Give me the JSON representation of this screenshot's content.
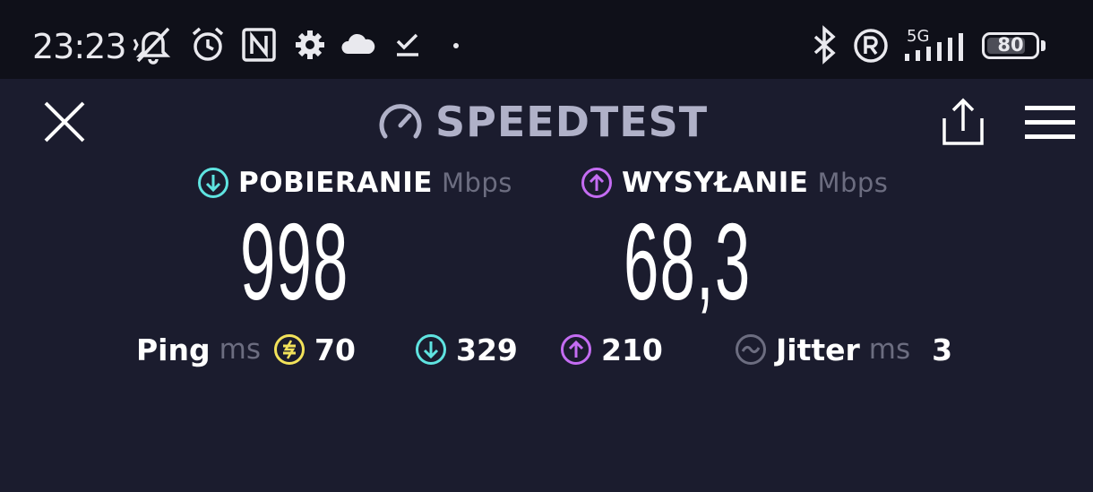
{
  "status_bar": {
    "time": "23:23",
    "network": "5G",
    "battery_level": "80",
    "battery_fraction": 0.8,
    "icons": [
      "muted-bell-icon",
      "alarm-icon",
      "nfc-icon",
      "settings-icon",
      "cloud-icon",
      "download-done-icon",
      "dot-icon",
      "bluetooth-icon",
      "registered-icon",
      "signal-icon",
      "battery-icon"
    ]
  },
  "header": {
    "title": "SPEEDTEST",
    "close_icon": "close-icon",
    "share_icon": "share-icon",
    "menu_icon": "menu-icon"
  },
  "download": {
    "label": "POBIERANIE",
    "unit": "Mbps",
    "value": "998",
    "color": "#5fe3e0"
  },
  "upload": {
    "label": "WYSYŁANIE",
    "unit": "Mbps",
    "value": "68,3",
    "color": "#c46cf2"
  },
  "ping": {
    "label": "Ping",
    "unit": "ms",
    "idle_value": "70",
    "download_value": "329",
    "upload_value": "210",
    "idle_color": "#f2e25a"
  },
  "jitter": {
    "label": "Jitter",
    "unit": "ms",
    "value": "3",
    "color": "#6c6d80"
  }
}
